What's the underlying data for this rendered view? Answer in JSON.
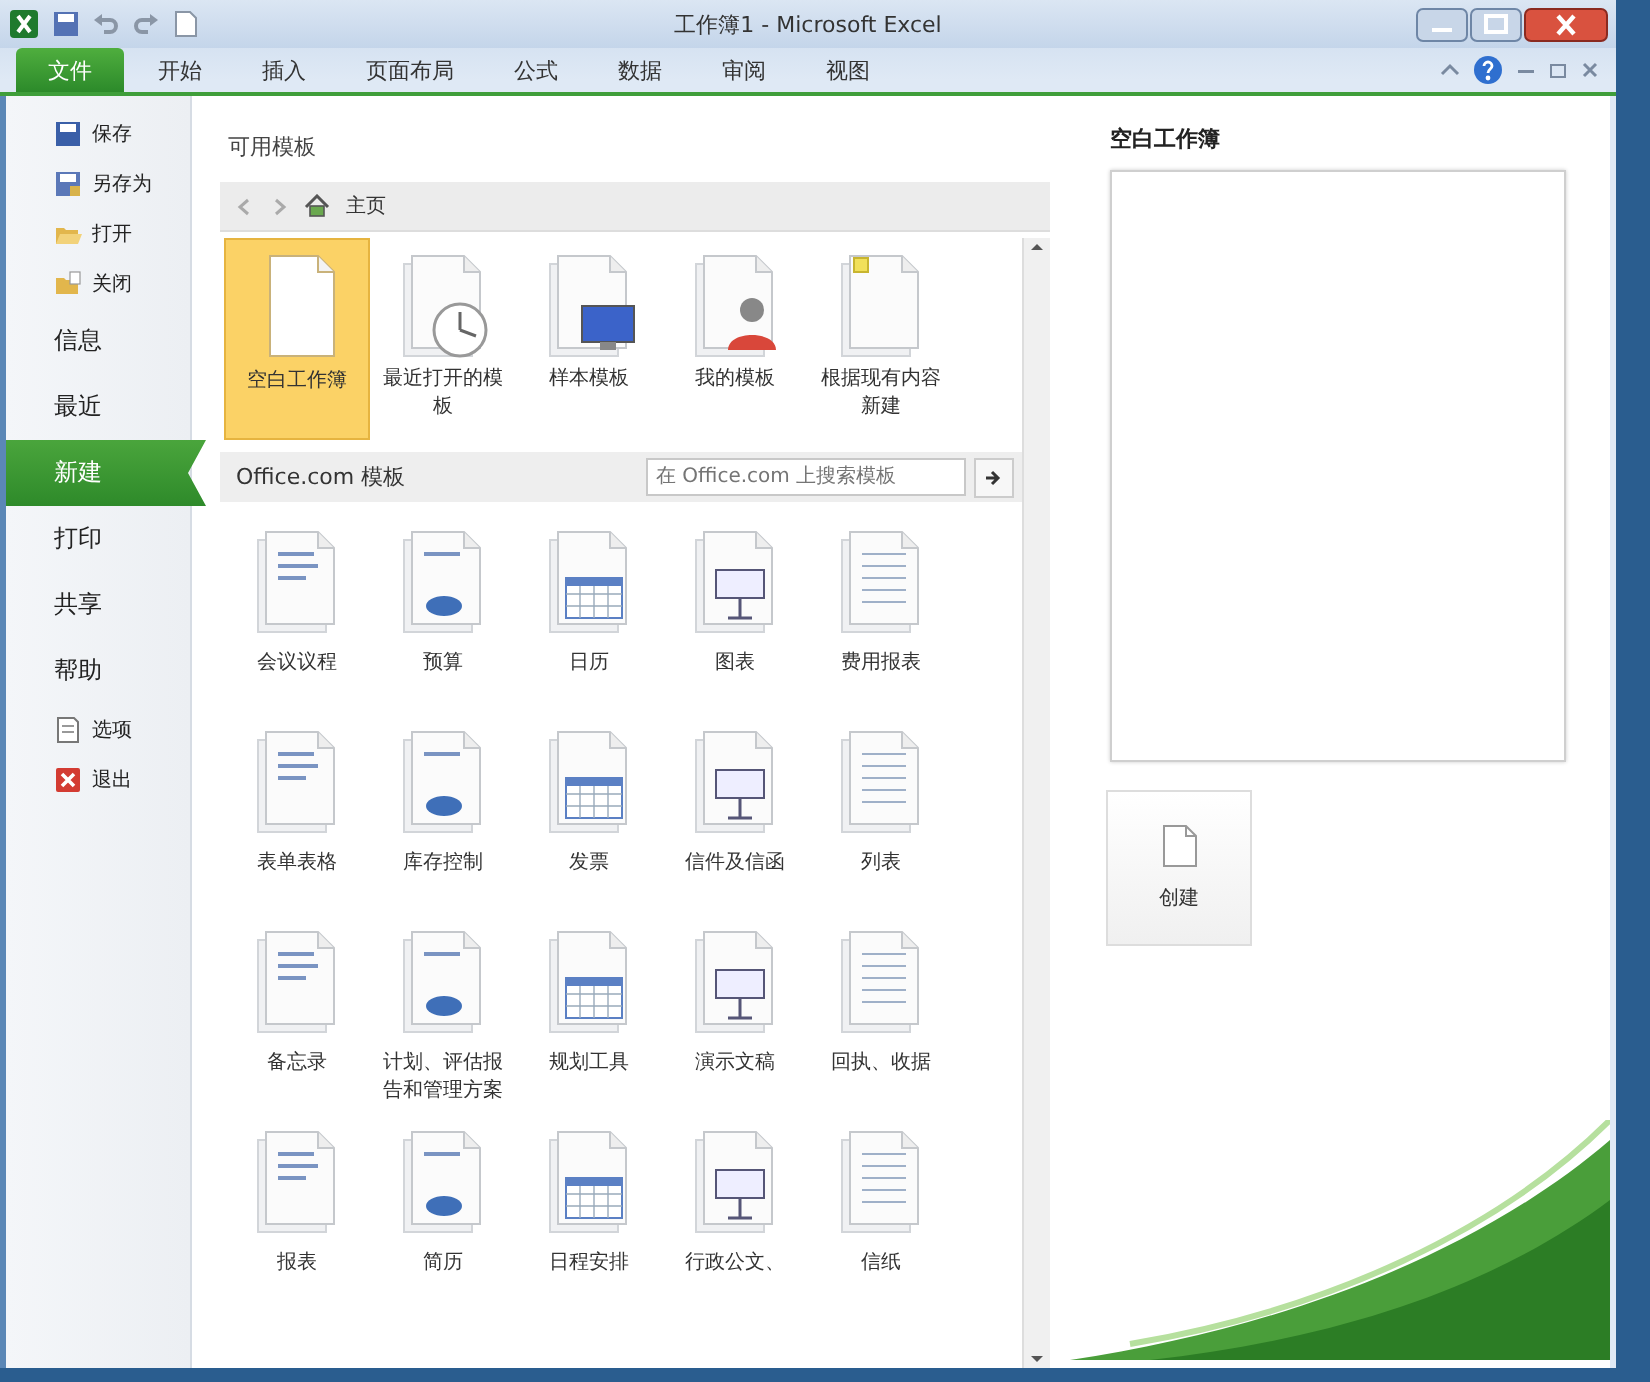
{
  "window": {
    "title": "工作簿1 - Microsoft Excel"
  },
  "ribbon_tabs": [
    {
      "label": "文件",
      "kind": "file",
      "selected": true
    },
    {
      "label": "开始",
      "kind": "tab",
      "selected": false
    },
    {
      "label": "插入",
      "kind": "tab",
      "selected": false
    },
    {
      "label": "页面布局",
      "kind": "tab",
      "selected": false
    },
    {
      "label": "公式",
      "kind": "tab",
      "selected": false
    },
    {
      "label": "数据",
      "kind": "tab",
      "selected": false
    },
    {
      "label": "审阅",
      "kind": "tab",
      "selected": false
    },
    {
      "label": "视图",
      "kind": "tab",
      "selected": false
    }
  ],
  "sidebar": {
    "items": [
      {
        "label": "保存",
        "kind": "save",
        "selected": false
      },
      {
        "label": "另存为",
        "kind": "saveas",
        "selected": false
      },
      {
        "label": "打开",
        "kind": "open",
        "selected": false
      },
      {
        "label": "关闭",
        "kind": "close",
        "selected": false
      },
      {
        "label": "信息",
        "kind": "page",
        "selected": false
      },
      {
        "label": "最近",
        "kind": "page",
        "selected": false
      },
      {
        "label": "新建",
        "kind": "page",
        "selected": true
      },
      {
        "label": "打印",
        "kind": "page",
        "selected": false
      },
      {
        "label": "共享",
        "kind": "page",
        "selected": false
      },
      {
        "label": "帮助",
        "kind": "page",
        "selected": false
      },
      {
        "label": "选项",
        "kind": "options",
        "selected": false
      },
      {
        "label": "退出",
        "kind": "exit",
        "selected": false
      }
    ]
  },
  "templates": {
    "heading": "可用模板",
    "breadcrumb": "主页",
    "featured": [
      {
        "label": "空白工作簿",
        "kind": "blank",
        "selected": true
      },
      {
        "label": "最近打开的模板",
        "kind": "recent",
        "selected": false
      },
      {
        "label": "样本模板",
        "kind": "sample",
        "selected": false
      },
      {
        "label": "我的模板",
        "kind": "mine",
        "selected": false
      },
      {
        "label": "根据现有内容新建",
        "kind": "existing",
        "selected": false
      }
    ],
    "office_heading": "Office.com 模板",
    "search": {
      "placeholder": "在 Office.com 上搜索模板"
    },
    "categories": [
      {
        "label": "会议议程"
      },
      {
        "label": "预算"
      },
      {
        "label": "日历"
      },
      {
        "label": "图表"
      },
      {
        "label": "费用报表"
      },
      {
        "label": "表单表格"
      },
      {
        "label": "库存控制"
      },
      {
        "label": "发票"
      },
      {
        "label": "信件及信函"
      },
      {
        "label": "列表"
      },
      {
        "label": "备忘录"
      },
      {
        "label": "计划、评估报告和管理方案"
      },
      {
        "label": "规划工具"
      },
      {
        "label": "演示文稿"
      },
      {
        "label": "回执、收据"
      },
      {
        "label": "报表"
      },
      {
        "label": "简历"
      },
      {
        "label": "日程安排"
      },
      {
        "label": "行政公文、"
      },
      {
        "label": "信纸"
      }
    ]
  },
  "preview": {
    "title": "空白工作簿",
    "create_button": "创建"
  }
}
